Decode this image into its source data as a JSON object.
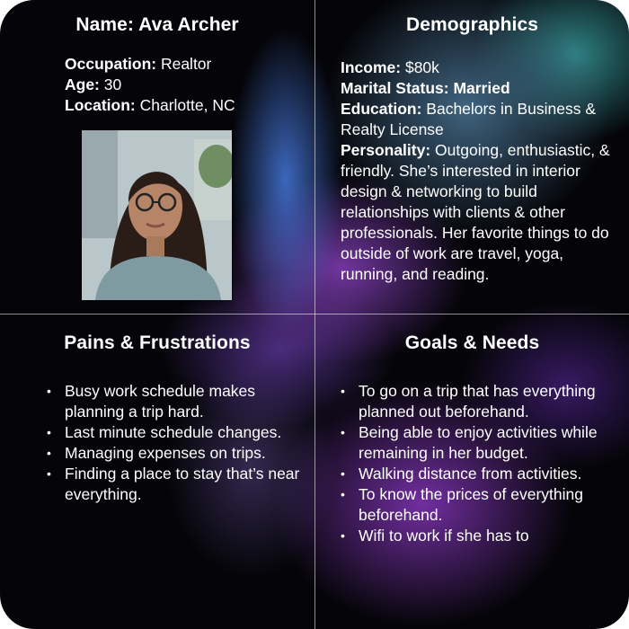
{
  "profile": {
    "name_title": "Name: Ava Archer",
    "occupation_label": "Occupation:",
    "occupation_value": " Realtor",
    "age_label": "Age:",
    "age_value": " 30",
    "location_label": "Location:",
    "location_value": " Charlotte, NC"
  },
  "demographics": {
    "title": "Demographics",
    "income_label": "Income:",
    "income_value": " $80k",
    "marital_label": "Marital Status: Married",
    "education_label": "Education:",
    "education_value": " Bachelors in Business & Realty License",
    "personality_label": "Personality:",
    "personality_value": " Outgoing, enthusiastic, & friendly. She’s interested in interior design & networking to build relationships with clients & other professionals. Her favorite things to do outside of work are travel, yoga, running, and reading."
  },
  "pains": {
    "title": "Pains & Frustrations",
    "items": [
      "Busy work schedule makes planning a trip hard.",
      "Last minute schedule changes.",
      "Managing expenses on trips.",
      "Finding a place to stay that’s near everything."
    ]
  },
  "goals": {
    "title": "Goals & Needs",
    "items": [
      "To go on a trip that has everything planned out beforehand.",
      "Being able to enjoy activities while remaining in her budget.",
      "Walking distance from activities.",
      "To know the prices of everything beforehand.",
      "Wifi to work if she has to"
    ]
  },
  "colors": {
    "background": "#050509",
    "text": "#ffffff",
    "accent_purple": "#9646d2",
    "accent_teal": "#3caaaa"
  }
}
